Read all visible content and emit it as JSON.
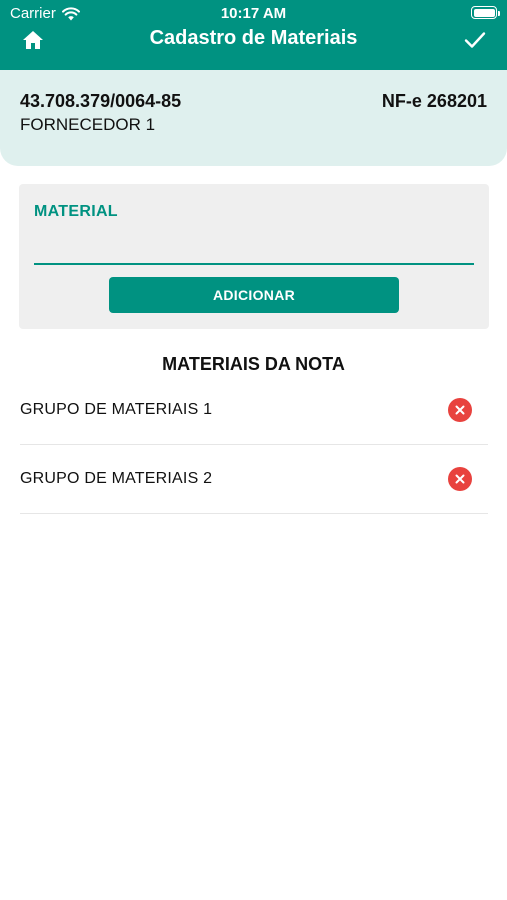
{
  "status_bar": {
    "carrier": "Carrier",
    "time": "10:17 AM"
  },
  "nav": {
    "title": "Cadastro de Materiais",
    "home_icon": "home-icon",
    "confirm_icon": "check-icon"
  },
  "invoice": {
    "cnpj": "43.708.379/0064-85",
    "nfe": "NF-e 268201",
    "supplier": "FORNECEDOR 1"
  },
  "form": {
    "material_label": "MATERIAL",
    "material_value": "",
    "add_label": "ADICIONAR"
  },
  "materials": {
    "title": "MATERIAIS DA NOTA",
    "items": [
      {
        "label": "GRUPO DE MATERIAIS 1"
      },
      {
        "label": "GRUPO DE MATERIAIS 2"
      }
    ]
  },
  "colors": {
    "primary": "#009281",
    "header_panel": "#dff0ee",
    "remove": "#e8423e"
  }
}
